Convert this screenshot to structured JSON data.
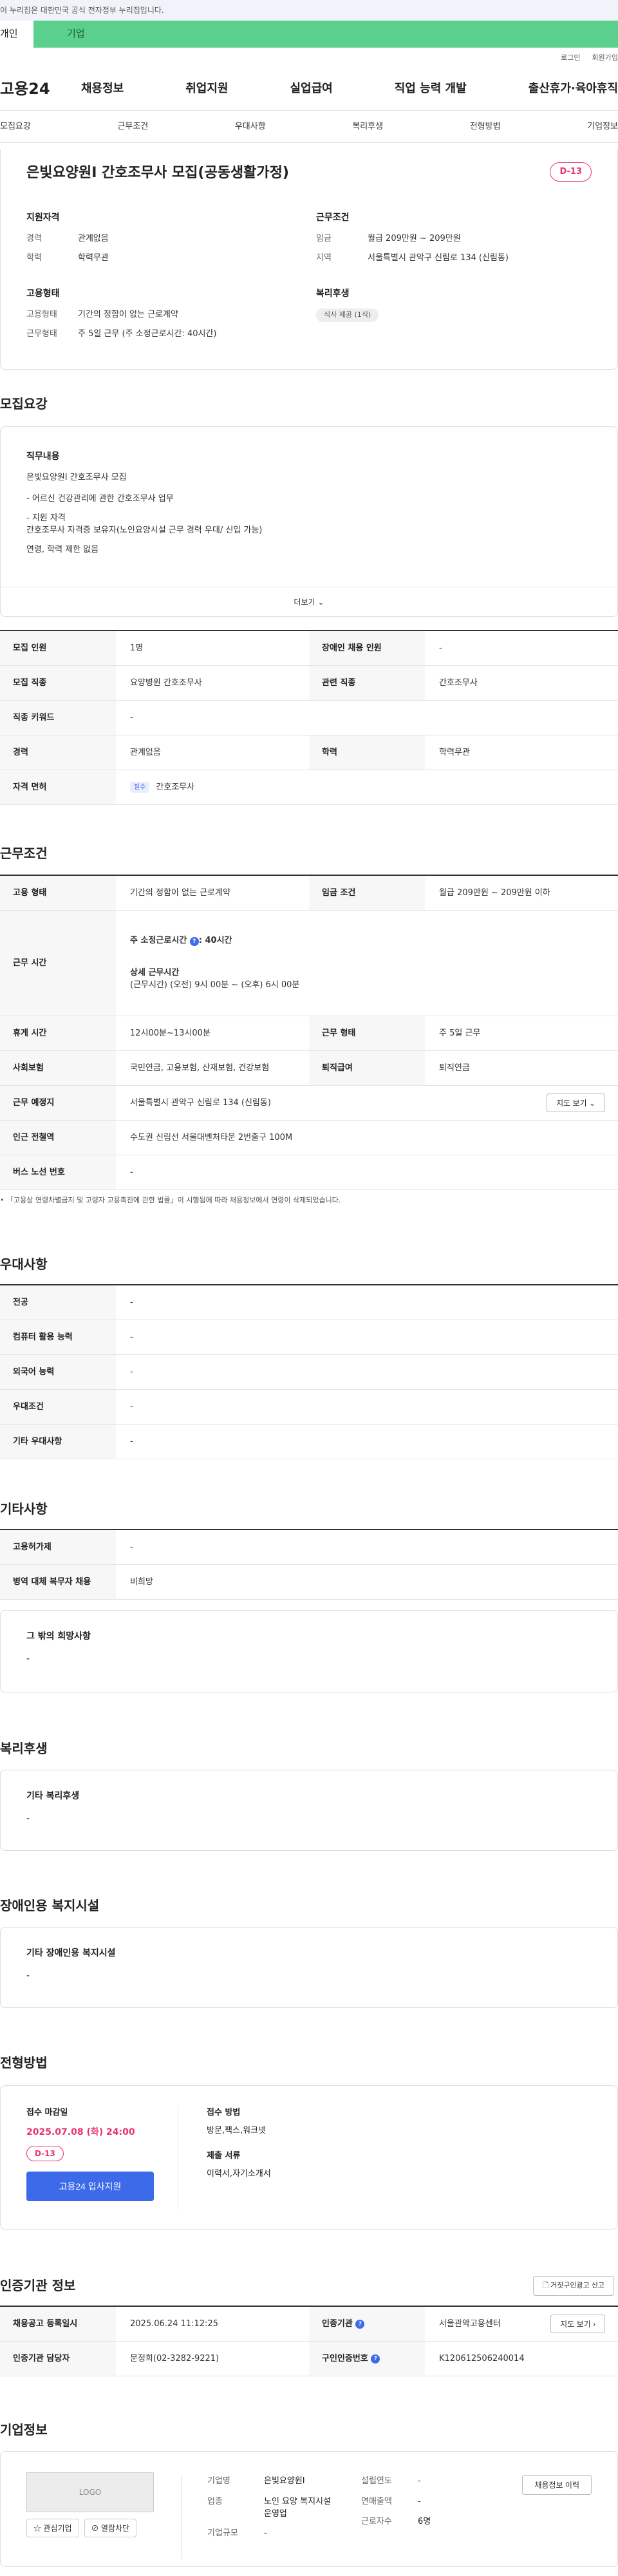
{
  "gov_banner": "이 누리집은 대한민국 공식 전자정부 누리집입니다.",
  "top_tabs": [
    "개인",
    "기업"
  ],
  "util_links": [
    "로그인",
    "회원가입"
  ],
  "brand": "고용24",
  "gnb": [
    "채용정보",
    "취업지원",
    "실업급여",
    "직업 능력 개발",
    "출산휴가·육아휴직"
  ],
  "section_tabs": [
    "모집요강",
    "근무조건",
    "우대사항",
    "복리후생",
    "전형방법",
    "기업정보"
  ],
  "header": {
    "title": "은빛요양원I 간호조무사 모집(공동생활가정)",
    "dday": "D-13",
    "qual_title": "지원자격",
    "career_k": "경력",
    "career_v": "관계없음",
    "edu_k": "학력",
    "edu_v": "학력무관",
    "cond_title": "근무조건",
    "wage_k": "임금",
    "wage_v": "월급 209만원 ~ 209만원",
    "region_k": "지역",
    "region_v": "서울특별시 관악구 신림로 134 (신림동)",
    "emp_title": "고용형태",
    "type_k": "고용형태",
    "type_v": "기간의 정함이 없는 근로계약",
    "work_k": "근무형태",
    "work_v": "주 5일 근무 (주 소정근로시간: 40시간)",
    "welfare_title": "복리후생",
    "welfare_chip": "식사 제공 (1식)"
  },
  "recruit": {
    "title": "모집요강",
    "duty_title": "직무내용",
    "duty_lines": [
      "은빛요양원I 간호조무사 모집",
      "- 어르신 건강관리에 관한 간호조무사 업무",
      "- 지원 자격",
      "  간호조무사 자격증 보유자(노인요양시설 근무 경력 우대/ 신입 가능)",
      "  연령, 학력 제한 없음"
    ],
    "more": "더보기",
    "rows": [
      {
        "k1": "모집 인원",
        "v1": "1명",
        "k2": "장애인 채용 인원",
        "v2": "-"
      },
      {
        "k1": "모집 직종",
        "v1": "요양병원 간호조무사",
        "k2": "관련 직종",
        "v2": "간호조무사"
      },
      {
        "k1": "직종 키워드",
        "v1": "-"
      },
      {
        "k1": "경력",
        "v1": "관계없음",
        "k2": "학력",
        "v2": "학력무관"
      },
      {
        "k1": "자격 면허",
        "v1": "간호조무사",
        "tag": "필수"
      }
    ]
  },
  "conditions": {
    "title": "근무조건",
    "emp_k": "고용 형태",
    "emp_v": "기간의 정함이 없는 근로계약",
    "wage_k": "임금 조건",
    "wage_v": "월급 209만원 ~ 209만원 이하",
    "hours_k": "근무 시간",
    "hours_weekly": "주 소정근로시간",
    "hours_weekly_v": ": 40시간",
    "hours_detail_t": "상세 근무시간",
    "hours_detail_v": "(근무시간) (오전) 9시 00분 ~ (오후) 6시 00분",
    "rest_k": "휴게 시간",
    "rest_v": "12시00분~13시00분",
    "form_k": "근무 형태",
    "form_v": "주 5일 근무",
    "ins_k": "사회보험",
    "ins_v": "국민연금, 고용보험, 산재보험, 건강보험",
    "ret_k": "퇴직급여",
    "ret_v": "퇴직연금",
    "place_k": "근무 예정지",
    "place_v": "서울특별시 관악구 신림로 134 (신림동)",
    "map_btn": "지도 보기",
    "subway_k": "인근 전철역",
    "subway_v": "수도권 신림선 서울대벤처타운 2번출구 100M",
    "bus_k": "버스 노선 번호",
    "bus_v": "-",
    "note": "「고용상 연령차별금지 및 고령자 고용촉진에 관한 법률」이 시행됨에 따라 채용정보에서 연령이 삭제되었습니다."
  },
  "pref": {
    "title": "우대사항",
    "rows": [
      {
        "k": "전공",
        "v": "-"
      },
      {
        "k": "컴퓨터 활용 능력",
        "v": "-"
      },
      {
        "k": "외국어 능력",
        "v": "-"
      },
      {
        "k": "우대조건",
        "v": "-"
      },
      {
        "k": "기타 우대사항",
        "v": "-"
      }
    ]
  },
  "etc": {
    "title": "기타사항",
    "rows": [
      {
        "k": "고용허가제",
        "v": "-"
      },
      {
        "k": "병역 대체 복무자 채용",
        "v": "비희망"
      }
    ],
    "hope_title": "그 밖의 희망사항",
    "hope_v": "-"
  },
  "welfare": {
    "title": "복리후생",
    "box_title": "기타 복리후생",
    "box_v": "-"
  },
  "disabled": {
    "title": "장애인용 복지시설",
    "box_title": "기타 장애인용 복지시설",
    "box_v": "-"
  },
  "process": {
    "title": "전형방법",
    "deadline_t": "접수 마감일",
    "deadline_v": "2025.07.08 (화) 24:00",
    "dday": "D-13",
    "apply_btn": "고용24 입사지원",
    "method_t": "접수 방법",
    "method_v": "방문,팩스,워크넷",
    "docs_t": "제출 서류",
    "docs_v": "이력서,자기소개서"
  },
  "cert": {
    "title": "인증기관 정보",
    "report_btn": "거짓구인광고 신고",
    "reg_k": "채용공고 등록일시",
    "reg_v": "2025.06.24 11:12:25",
    "org_k": "인증기관",
    "org_v": "서울관악고용센터",
    "map_btn": "지도 보기",
    "mgr_k": "인증기관 담당자",
    "mgr_v": "문정희(02-3282-9221)",
    "num_k": "구인인증번호",
    "num_v": "K120612506240014"
  },
  "company": {
    "title": "기업정보",
    "logo": "LOGO",
    "fav_btn": "관심기업",
    "block_btn": "열람차단",
    "name_k": "기업명",
    "name_v": "은빛요양원I",
    "ind_k": "업종",
    "ind_v": "노인 요양 복지시설 운영업",
    "size_k": "기업규모",
    "size_v": "-",
    "year_k": "설립연도",
    "year_v": "-",
    "sales_k": "연매출액",
    "sales_v": "-",
    "emp_k": "근로자수",
    "emp_v": "6명",
    "history_btn": "채용정보 이력"
  }
}
